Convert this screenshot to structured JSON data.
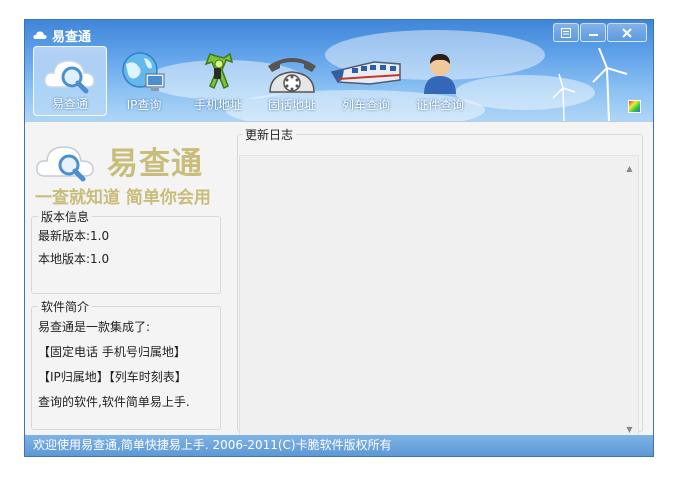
{
  "window": {
    "title": "易查通",
    "accent": "#3f74ad"
  },
  "toolbar": {
    "items": [
      {
        "label": "易查通",
        "icon": "cloud-search-icon",
        "active": true
      },
      {
        "label": "IP查询",
        "icon": "globe-computer-icon",
        "active": false
      },
      {
        "label": "手机地址",
        "icon": "phone-figure-icon",
        "active": false
      },
      {
        "label": "固话地址",
        "icon": "telephone-icon",
        "active": false
      },
      {
        "label": "列车查询",
        "icon": "train-icon",
        "active": false
      },
      {
        "label": "证件查询",
        "icon": "person-icon",
        "active": false
      }
    ]
  },
  "logo": {
    "title": "易查通",
    "slogan": "一查就知道 简单你会用",
    "color": "#c8bd7a"
  },
  "version": {
    "legend": "版本信息",
    "latest": "最新版本:1.0",
    "local": "本地版本:1.0"
  },
  "intro": {
    "legend": "软件简介",
    "lines": [
      "易查通是一款集成了:",
      "【固定电话 手机号归属地】",
      "【IP归属地】【列车时刻表】",
      "查询的软件,软件简单易上手."
    ]
  },
  "log": {
    "legend": "更新日志"
  },
  "status": {
    "text": "欢迎使用易查通,简单快捷易上手. 2006-2011(C)卡脆软件版权所有"
  }
}
